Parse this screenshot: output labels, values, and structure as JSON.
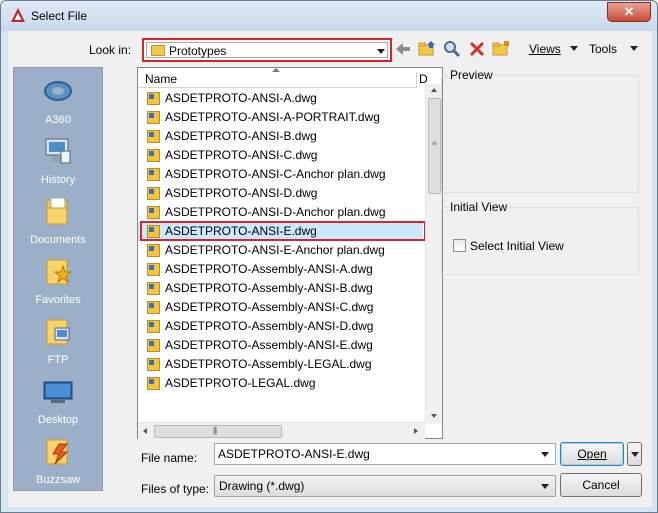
{
  "window": {
    "title": "Select File",
    "close_label": "✕"
  },
  "toolbar": {
    "look_in_label": "Look in:",
    "look_in_value": "Prototypes",
    "views_label": "Views",
    "tools_label": "Tools"
  },
  "places": [
    {
      "label": "A360",
      "icon": "a360-icon"
    },
    {
      "label": "History",
      "icon": "history-icon"
    },
    {
      "label": "Documents",
      "icon": "documents-icon"
    },
    {
      "label": "Favorites",
      "icon": "favorites-icon"
    },
    {
      "label": "FTP",
      "icon": "ftp-icon"
    },
    {
      "label": "Desktop",
      "icon": "desktop-icon"
    },
    {
      "label": "Buzzsaw",
      "icon": "buzzsaw-icon"
    }
  ],
  "file_list": {
    "column_name": "Name",
    "column_d": "D",
    "selected_index": 9,
    "files": [
      "ASDETPROTO-ANSI-A.dwg",
      "ASDETPROTO-ANSI-A-PORTRAIT.dwg",
      "ASDETPROTO-ANSI-B.dwg",
      "ASDETPROTO-ANSI-C.dwg",
      "ASDETPROTO-ANSI-C-Anchor plan.dwg",
      "ASDETPROTO-ANSI-D.dwg",
      "ASDETPROTO-ANSI-D-Anchor plan.dwg",
      "ASDETPROTO-ANSI-E.dwg",
      "ASDETPROTO-ANSI-E-Anchor plan.dwg",
      "ASDETPROTO-Assembly-ANSI-A.dwg",
      "ASDETPROTO-Assembly-ANSI-B.dwg",
      "ASDETPROTO-Assembly-ANSI-C.dwg",
      "ASDETPROTO-Assembly-ANSI-D.dwg",
      "ASDETPROTO-Assembly-ANSI-E.dwg",
      "ASDETPROTO-Assembly-LEGAL.dwg",
      "ASDETPROTO-LEGAL.dwg"
    ]
  },
  "preview": {
    "title": "Preview"
  },
  "initial_view": {
    "title": "Initial View",
    "checkbox_label": "Select Initial View",
    "checked": false
  },
  "footer": {
    "file_name_label": "File name:",
    "file_name_value": "ASDETPROTO-ANSI-E.dwg",
    "files_of_type_label": "Files of type:",
    "files_of_type_value": "Drawing (*.dwg)",
    "open_label": "Open",
    "cancel_label": "Cancel"
  },
  "colors": {
    "highlight_red": "#d7262b",
    "places_panel": "#9bb0c8",
    "selection": "#cce8ff"
  }
}
